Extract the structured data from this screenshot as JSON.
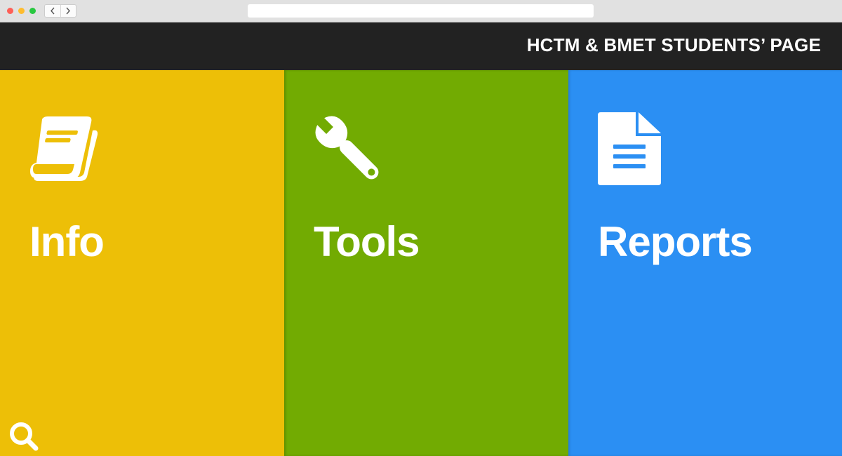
{
  "site": {
    "title": "HCTM & BMET STUDENTS’ PAGE"
  },
  "tiles": [
    {
      "label": "Info",
      "icon": "book-icon",
      "color": "#edbf07"
    },
    {
      "label": "Tools",
      "icon": "wrench-icon",
      "color": "#72ab02"
    },
    {
      "label": "Reports",
      "icon": "document-icon",
      "color": "#2b8ff3"
    }
  ],
  "search": {
    "icon": "search-icon"
  },
  "colors": {
    "header": "#222222",
    "text": "#ffffff"
  }
}
